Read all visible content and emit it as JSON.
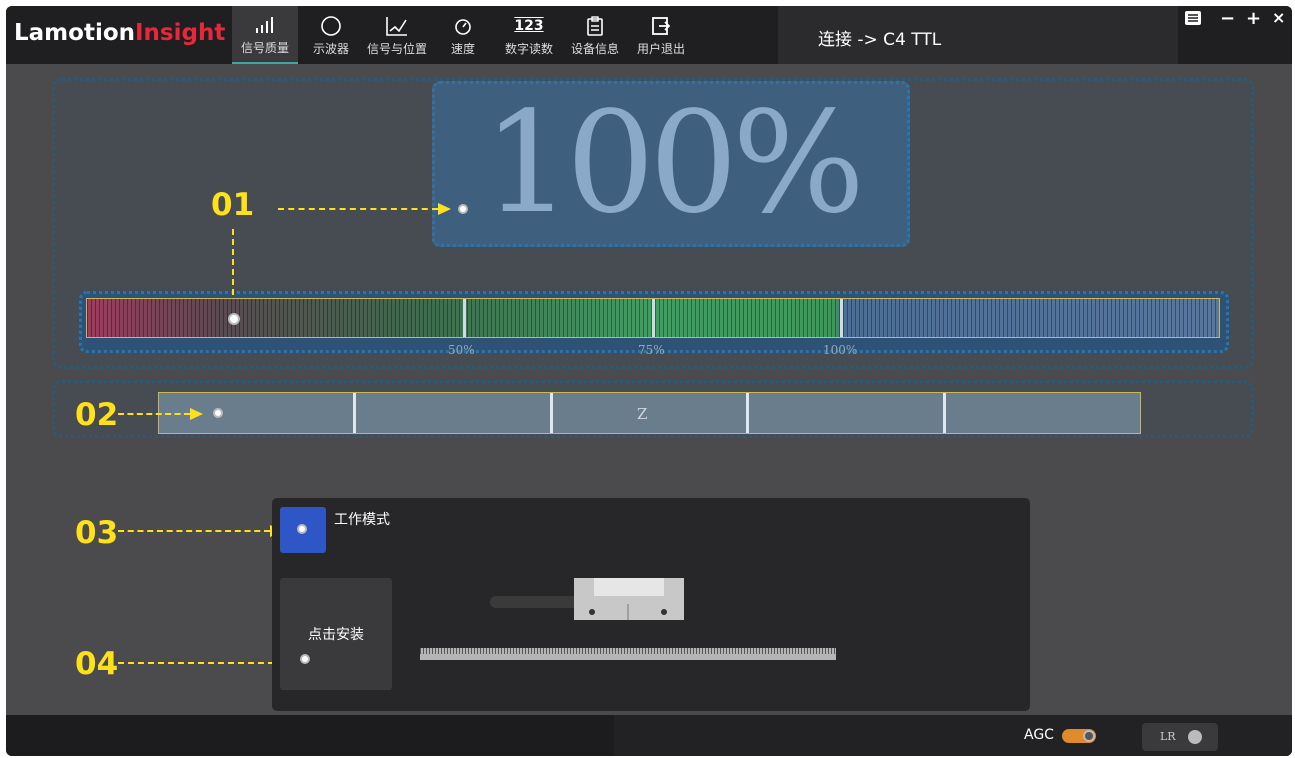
{
  "app": {
    "logo_part1": "Lamotion",
    "logo_part2": "Insight"
  },
  "nav": [
    {
      "label": "信号质量",
      "icon": "signal-bars-icon",
      "active": true
    },
    {
      "label": "示波器",
      "icon": "circle-icon"
    },
    {
      "label": "信号与位置",
      "icon": "line-graph-icon"
    },
    {
      "label": "速度",
      "icon": "speedometer-icon"
    },
    {
      "label": "数字读数",
      "icon": "digits-123-icon"
    },
    {
      "label": "设备信息",
      "icon": "clipboard-icon"
    },
    {
      "label": "用户退出",
      "icon": "exit-icon"
    }
  ],
  "digits_glyph": "123",
  "connection": {
    "text": "连接 -> C4 TTL"
  },
  "window_controls": {
    "menu_icon": "list-icon",
    "minimize": "−",
    "maximize": "+",
    "close": "×"
  },
  "signal": {
    "percent_text": "100%",
    "ticks": [
      "50%",
      "75%",
      "100%"
    ],
    "level_fraction": 1.0
  },
  "z_bar": {
    "label": "Z"
  },
  "annotations": [
    "01",
    "02",
    "03",
    "04"
  ],
  "mode_panel": {
    "mode_label": "工作模式",
    "install_label": "点击安装"
  },
  "footer": {
    "agc_label": "AGC",
    "lr_label": "LR"
  },
  "colors": {
    "accent_yellow": "#ffe11a",
    "active_tab": "#3fa6a0",
    "mode_button": "#2e56c6",
    "agc_toggle": "#e08a2a"
  }
}
